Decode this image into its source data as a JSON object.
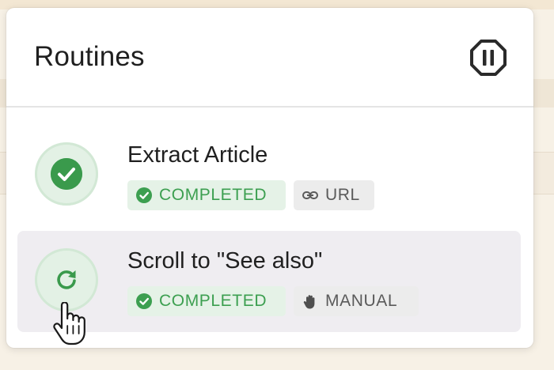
{
  "panel": {
    "title": "Routines",
    "pause_icon": "pause-octagon-icon"
  },
  "routines": [
    {
      "name": "Extract Article",
      "status_icon": "check-circle-icon",
      "status_label": "COMPLETED",
      "trigger_icon": "link-icon",
      "trigger_label": "URL"
    },
    {
      "name": "Scroll to \"See also\"",
      "status_icon": "refresh-icon",
      "status_label": "COMPLETED",
      "trigger_icon": "hand-icon",
      "trigger_label": "MANUAL"
    }
  ],
  "colors": {
    "accent_green": "#3a9a4c",
    "completed_bg": "#e5f2e7",
    "meta_tag_bg": "#ececec",
    "hover_row_bg": "#efedf1"
  }
}
